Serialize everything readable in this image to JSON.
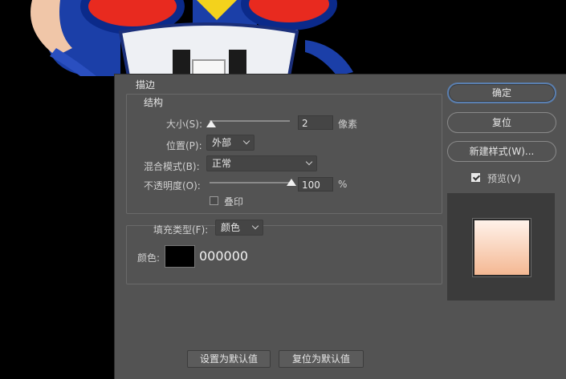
{
  "dialog": {
    "section_title": "描边",
    "structure": {
      "title": "结构",
      "size_label": "大小(S):",
      "size_value": "2",
      "size_unit": "像素",
      "size_fraction": 0.02,
      "position_label": "位置(P):",
      "position_value": "外部",
      "blend_label": "混合模式(B):",
      "blend_value": "正常",
      "opacity_label": "不透明度(O):",
      "opacity_value": "100",
      "opacity_unit": "%",
      "opacity_fraction": 1.0,
      "overprint_label": "叠印",
      "overprint_checked": false
    },
    "fill": {
      "type_label": "填充类型(F):",
      "type_value": "颜色",
      "color_label": "颜色:",
      "color_hex": "000000",
      "color_swatch": "#000000"
    },
    "footer": {
      "set_default": "设置为默认值",
      "reset_default": "复位为默认值"
    }
  },
  "side": {
    "ok": "确定",
    "reset": "复位",
    "new_style": "新建样式(W)...",
    "preview_label": "预览(V)",
    "preview_checked": true
  },
  "colors": {
    "dialog_bg": "#535353",
    "accent": "#5a7fb0"
  },
  "icons": [
    "checkbox-checked-icon",
    "checkbox-icon",
    "chevron-down-icon",
    "slider-thumb-icon"
  ]
}
